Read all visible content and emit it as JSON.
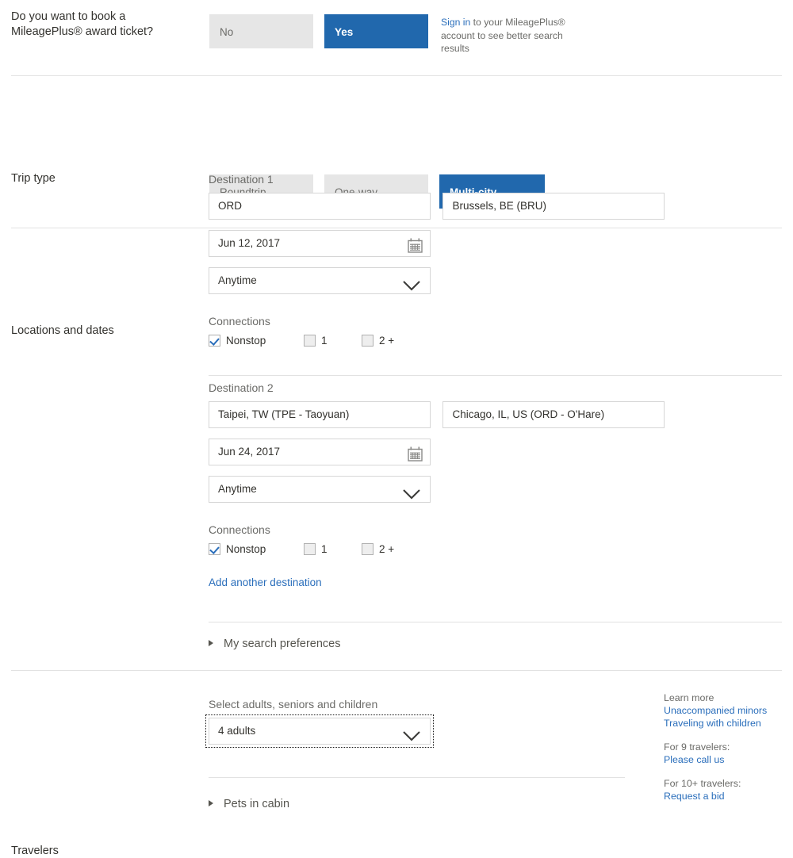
{
  "colors": {
    "accent_blue": "#2168ad",
    "link_blue": "#2a6ebb",
    "segment_gray": "#e6e6e6",
    "rule_gray": "#e2e2e2",
    "text_dark": "#33322e",
    "text_muted": "#6b6b68"
  },
  "award": {
    "question": "Do you want to book a MileagePlus® award ticket?",
    "options": [
      {
        "label": "No",
        "selected": false
      },
      {
        "label": "Yes",
        "selected": true
      }
    ],
    "note_link": "Sign in",
    "note_rest": " to your MileagePlus® account to see better search results"
  },
  "trip_type": {
    "label": "Trip type",
    "options": [
      {
        "label": "Roundtrip",
        "selected": false
      },
      {
        "label": "One-way",
        "selected": false
      },
      {
        "label": "Multi-city",
        "selected": true
      }
    ]
  },
  "locations": {
    "label": "Locations and dates",
    "connections_label": "Connections",
    "destinations": [
      {
        "heading": "Destination 1",
        "from": "ORD",
        "to": "Brussels, BE (BRU)",
        "date": "Jun 12, 2017",
        "time": "Anytime",
        "connections": [
          {
            "label": "Nonstop",
            "checked": true
          },
          {
            "label": "1",
            "checked": false
          },
          {
            "label": "2 +",
            "checked": false
          }
        ]
      },
      {
        "heading": "Destination 2",
        "from": "Taipei, TW (TPE - Taoyuan)",
        "to": "Chicago, IL, US (ORD - O'Hare)",
        "date": "Jun 24, 2017",
        "time": "Anytime",
        "connections": [
          {
            "label": "Nonstop",
            "checked": true
          },
          {
            "label": "1",
            "checked": false
          },
          {
            "label": "2 +",
            "checked": false
          }
        ]
      }
    ],
    "add_destination": "Add another destination",
    "search_preferences": "My search preferences"
  },
  "travelers": {
    "label": "Travelers",
    "select_label": "Select adults, seniors and children",
    "select_value": "4 adults",
    "pets": "Pets in cabin",
    "rail": {
      "learn_more": "Learn more",
      "unaccompanied_minors": "Unaccompanied minors",
      "traveling_with_children": "Traveling with children",
      "for_9": "For 9 travelers:",
      "please_call": "Please call us",
      "for_10": "For 10+ travelers:",
      "request_bid": "Request a bid"
    }
  },
  "icons": {
    "calendar": "calendar-icon",
    "chevron": "chevron-down-icon",
    "triangle": "triangle-right-icon",
    "check": "check-icon"
  }
}
